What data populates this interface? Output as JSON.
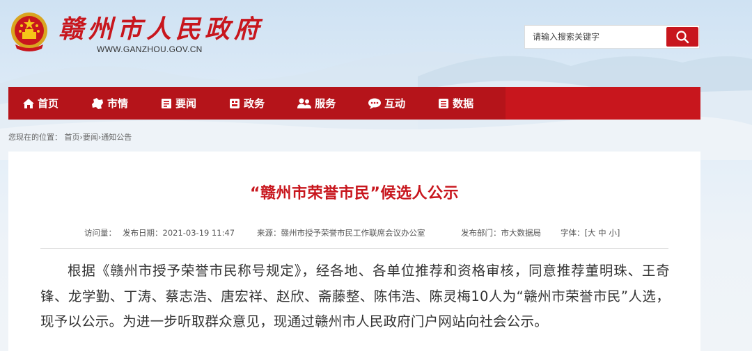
{
  "header": {
    "site_title": "赣州市人民政府",
    "site_url": "WWW.GANZHOU.GOV.CN"
  },
  "search": {
    "placeholder": "请输入搜索关键字",
    "button_icon": "search-icon"
  },
  "nav": {
    "items": [
      {
        "label": "首页",
        "icon": "home-icon"
      },
      {
        "label": "市情",
        "icon": "map-icon"
      },
      {
        "label": "要闻",
        "icon": "news-icon"
      },
      {
        "label": "政务",
        "icon": "government-icon"
      },
      {
        "label": "服务",
        "icon": "service-icon"
      },
      {
        "label": "互动",
        "icon": "chat-icon"
      },
      {
        "label": "数据",
        "icon": "data-icon"
      }
    ]
  },
  "breadcrumb": {
    "prefix": "您现在的位置：",
    "items": [
      "首页",
      "要闻",
      "通知公告"
    ],
    "separator": "›"
  },
  "article": {
    "title": "“赣州市荣誉市民”候选人公示",
    "meta": {
      "visits": "访问量：",
      "publish_date": "发布日期：2021-03-19 11:47",
      "source": "来源：赣州市授予荣誉市民工作联席会议办公室",
      "department": "发布部门：市大数据局",
      "font_size_label": "字体：[",
      "font_large": "大",
      "font_medium": "中",
      "font_small": "小",
      "font_close": "]"
    },
    "body": "根据《赣州市授予荣誉市民称号规定》，经各地、各单位推荐和资格审核，同意推荐董明珠、王奇锋、龙学勤、丁涛、蔡志浩、唐宏祥、赵欣、斋藤整、陈伟浩、陈灵梅10人为“赣州市荣誉市民”人选，现予以公示。为进一步听取群众意见，现通过赣州市人民政府门户网站向社会公示。"
  },
  "colors": {
    "brand_red": "#c8161d",
    "nav_dark": "#b5141a"
  }
}
